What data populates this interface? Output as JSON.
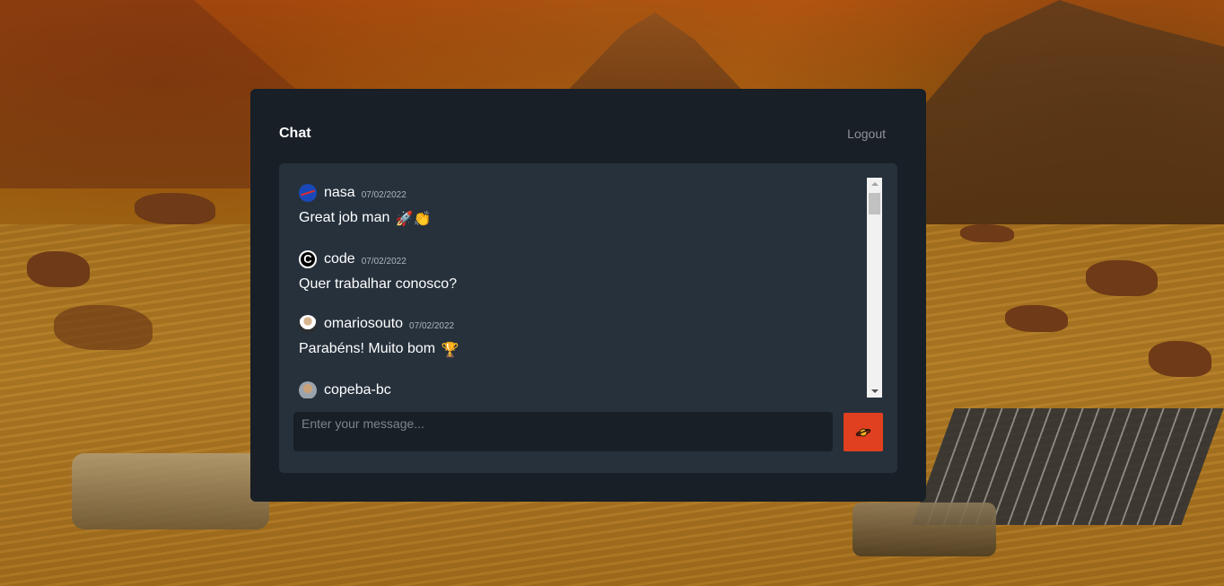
{
  "header": {
    "title": "Chat",
    "logout_label": "Logout"
  },
  "messages": [
    {
      "username": "nasa",
      "date": "07/02/2022",
      "text": "Great job man",
      "emoji": "🚀👏",
      "avatar": "nasa-logo"
    },
    {
      "username": "code",
      "date": "07/02/2022",
      "text": "Quer trabalhar conosco?",
      "emoji": "",
      "avatar": "code-logo"
    },
    {
      "username": "omariosouto",
      "date": "07/02/2022",
      "text": "Parabéns! Muito bom",
      "emoji": "🏆",
      "avatar": "user-photo"
    },
    {
      "username": "copeba-bc",
      "date": "",
      "text": "",
      "emoji": "",
      "avatar": "user-photo"
    }
  ],
  "composer": {
    "placeholder": "Enter your message...",
    "send_icon": "planet-icon"
  },
  "colors": {
    "panel": "#181f26",
    "chat_box": "#26313c",
    "send_button": "#e0401f",
    "text": "#ffffff",
    "muted": "#8d9298"
  }
}
